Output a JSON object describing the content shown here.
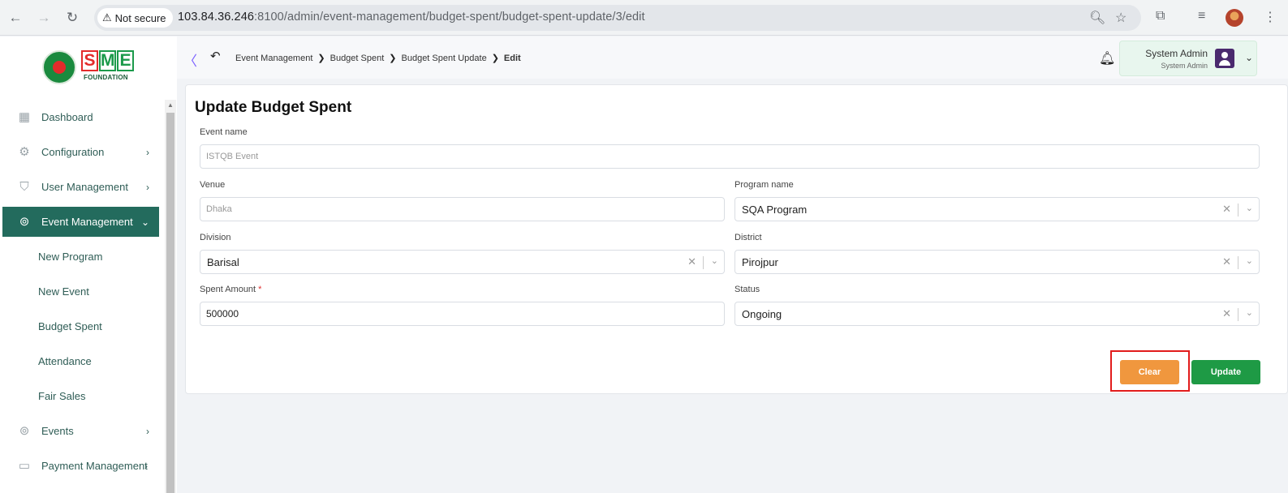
{
  "browser": {
    "security_label": "Not secure",
    "url_host": "103.84.36.246",
    "url_path": ":8100/admin/event-management/budget-spent/budget-spent-update/3/edit"
  },
  "sidebar": {
    "logo_text": "SME",
    "logo_sub": "FOUNDATION",
    "items": [
      {
        "label": "Dashboard",
        "icon": "dashboard-icon"
      },
      {
        "label": "Configuration",
        "icon": "configuration-icon"
      },
      {
        "label": "User Management",
        "icon": "user-shield-icon"
      },
      {
        "label": "Event Management",
        "icon": "lock-icon"
      },
      {
        "label": "Events",
        "icon": "lock-icon"
      },
      {
        "label": "Payment Management",
        "icon": "payment-icon"
      }
    ],
    "sub_items": [
      "New Program",
      "New Event",
      "Budget Spent",
      "Attendance",
      "Fair Sales"
    ]
  },
  "header": {
    "breadcrumb": [
      "Event Management",
      "Budget Spent",
      "Budget Spent Update",
      "Edit"
    ],
    "user_name": "System Admin",
    "user_role": "System Admin"
  },
  "form": {
    "title": "Update Budget Spent",
    "event_name": {
      "label": "Event name",
      "value": "ISTQB Event"
    },
    "venue": {
      "label": "Venue",
      "value": "Dhaka"
    },
    "program_name": {
      "label": "Program name",
      "value": "SQA Program"
    },
    "division": {
      "label": "Division",
      "value": "Barisal"
    },
    "district": {
      "label": "District",
      "value": "Pirojpur"
    },
    "spent_amount": {
      "label": "Spent Amount",
      "required_mark": "*",
      "value": "500000"
    },
    "status": {
      "label": "Status",
      "value": "Ongoing"
    },
    "clear_label": "Clear",
    "update_label": "Update"
  },
  "colors": {
    "sidebar_active": "#236b5d",
    "clear_button": "#f0973e",
    "update_button": "#1e9a45",
    "highlight": "#e21c1c"
  }
}
